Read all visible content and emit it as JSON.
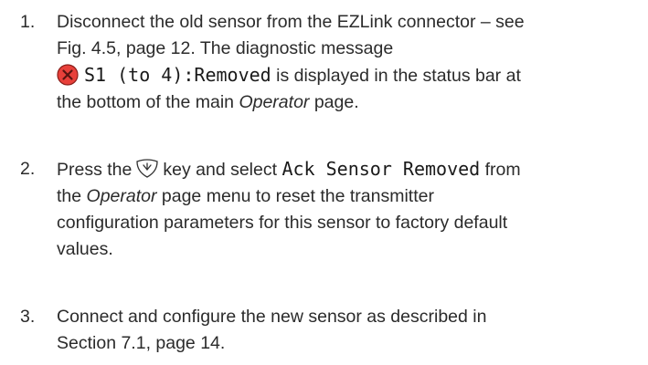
{
  "steps": [
    {
      "number": "1.",
      "line1": "Disconnect the old sensor from the EZLink connector – see",
      "line2": "Fig. 4.5, page 12. The diagnostic message",
      "line3_code": "S1 (to 4):Removed",
      "line3_after": " is displayed in the status bar at",
      "line4_before": "the bottom of the main ",
      "line4_em": "Operator",
      "line4_after": " page."
    },
    {
      "number": "2.",
      "line1_before": "Press the",
      "line1_mid": "key and select ",
      "line1_code": "Ack Sensor Removed",
      "line1_after": " from",
      "line2_before": "the ",
      "line2_em": "Operator",
      "line2_after": " page menu to reset the transmitter",
      "line3": "configuration parameters for this sensor to factory default",
      "line4": "values."
    },
    {
      "number": "3.",
      "line1": "Connect and configure the new sensor as described in",
      "line2": "Section 7.1, page 14."
    }
  ],
  "icons": {
    "error": "error-circle-icon",
    "menu_key": "down-arrow-key-icon"
  },
  "colors": {
    "text": "#2b2b2b",
    "error_fill": "#e8403a",
    "error_stroke": "#8a1f1a"
  }
}
